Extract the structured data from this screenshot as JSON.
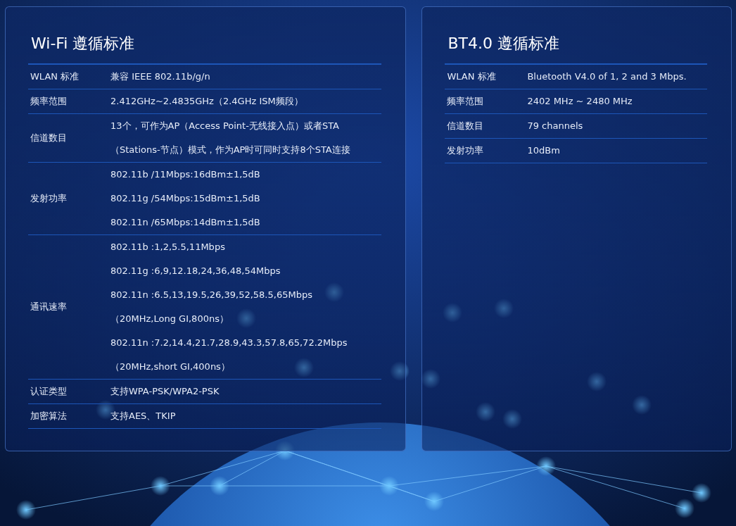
{
  "panels": [
    {
      "title": "Wi-Fi 遵循标准",
      "rows": [
        {
          "label": "WLAN 标准",
          "values": [
            "兼容 IEEE 802.11b/g/n"
          ]
        },
        {
          "label": "频率范围",
          "values": [
            "2.412GHz~2.4835GHz（2.4GHz ISM频段）"
          ]
        },
        {
          "label": "信道数目",
          "values": [
            "13个，可作为AP（Access Point-无线接入点）或者STA（Stations-节点）模式，作为AP时可同时支持8个STA连接"
          ]
        },
        {
          "label": "发射功率",
          "values": [
            "802.11b /11Mbps:16dBm±1,5dB",
            "802.11g /54Mbps:15dBm±1,5dB",
            "802.11n /65Mbps:14dBm±1,5dB"
          ]
        },
        {
          "label": "通讯速率",
          "values": [
            "802.11b :1,2,5.5,11Mbps",
            "802.11g :6,9,12.18,24,36,48,54Mbps",
            "802.11n :6.5,13,19.5,26,39,52,58.5,65Mbps",
            "（20MHz,Long GI,800ns）",
            "802.11n :7.2,14.4,21.7,28.9,43.3,57.8,65,72.2Mbps",
            "（20MHz,short GI,400ns）"
          ]
        },
        {
          "label": "认证类型",
          "values": [
            "支持WPA-PSK/WPA2-PSK"
          ]
        },
        {
          "label": "加密算法",
          "values": [
            "支持AES、TKIP"
          ]
        }
      ]
    },
    {
      "title": "BT4.0 遵循标准",
      "rows": [
        {
          "label": "WLAN 标准",
          "values": [
            "Bluetooth V4.0 of 1, 2 and 3 Mbps."
          ]
        },
        {
          "label": "频率范围",
          "values": [
            "2402 MHz ~ 2480 MHz"
          ]
        },
        {
          "label": "信道数目",
          "values": [
            "79 channels"
          ]
        },
        {
          "label": "发射功率",
          "values": [
            "10dBm"
          ]
        }
      ]
    }
  ]
}
